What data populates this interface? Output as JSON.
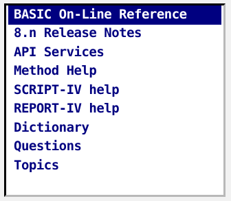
{
  "menu": {
    "selected_index": 0,
    "items": [
      {
        "label": "BASIC On-Line Reference"
      },
      {
        "label": "8.n Release Notes"
      },
      {
        "label": "API Services"
      },
      {
        "label": "Method Help"
      },
      {
        "label": "SCRIPT-IV help"
      },
      {
        "label": "REPORT-IV help"
      },
      {
        "label": "Dictionary"
      },
      {
        "label": "Questions"
      },
      {
        "label": "Topics"
      }
    ]
  },
  "colors": {
    "item_text": "#000080",
    "selection_background": "#000080",
    "selection_text": "#ffffff",
    "background": "#ffffff"
  }
}
